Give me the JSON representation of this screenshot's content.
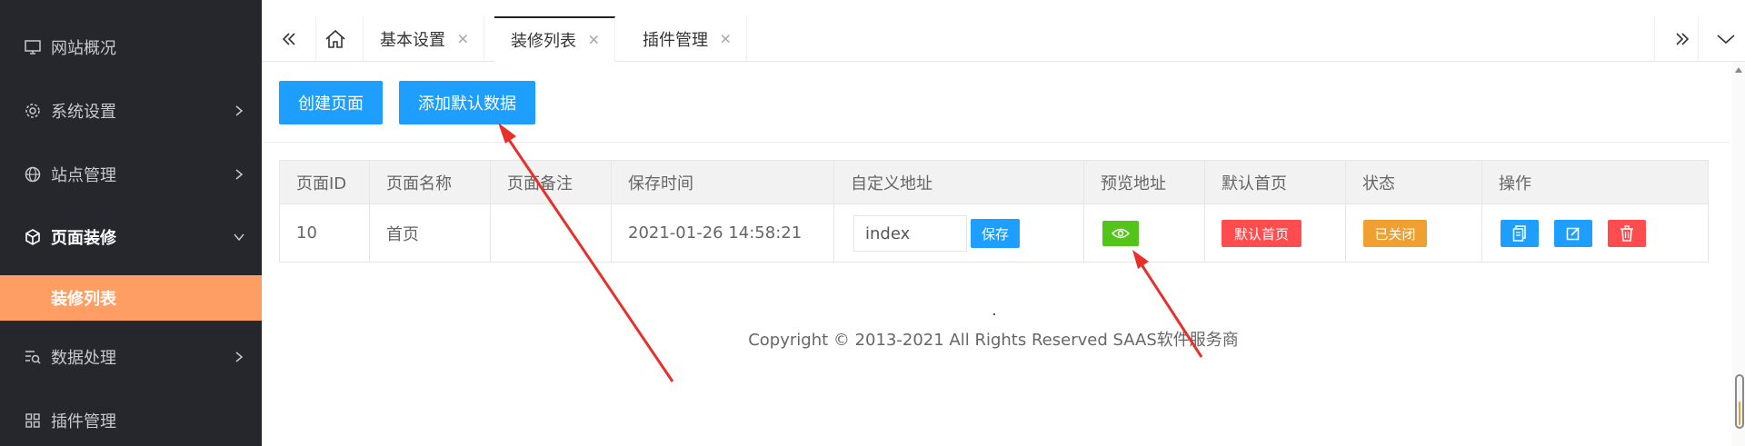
{
  "sidebar": {
    "items": [
      {
        "label": "网站概况",
        "icon": "monitor-icon"
      },
      {
        "label": "系统设置",
        "icon": "gear-icon"
      },
      {
        "label": "站点管理",
        "icon": "globe-icon"
      },
      {
        "label": "页面装修",
        "icon": "cube-icon"
      },
      {
        "label": "数据处理",
        "icon": "data-search-icon"
      },
      {
        "label": "插件管理",
        "icon": "grid-icon"
      }
    ],
    "sub_active": "装修列表"
  },
  "tabs": [
    {
      "label": "基本设置"
    },
    {
      "label": "装修列表"
    },
    {
      "label": "插件管理"
    }
  ],
  "toolbar": {
    "create_label": "创建页面",
    "add_default_label": "添加默认数据"
  },
  "table": {
    "headers": [
      "页面ID",
      "页面名称",
      "页面备注",
      "保存时间",
      "自定义地址",
      "预览地址",
      "默认首页",
      "状态",
      "操作"
    ],
    "rows": [
      {
        "id": "10",
        "name": "首页",
        "note": "",
        "saved_at": "2021-01-26 14:58:21",
        "custom_url": "index",
        "save_label": "保存",
        "default_home": "默认首页",
        "status": "已关闭"
      }
    ]
  },
  "footer": {
    "copyright": "Copyright © 2013-2021 All Rights Reserved SAAS软件服务商"
  },
  "colors": {
    "sidebar_bg": "#25272d",
    "active_orange": "#ff9e64",
    "primary_blue": "#1e9fff",
    "green": "#52c41a",
    "red": "#ff5555",
    "amber": "#f0a030",
    "annotation_red": "#e8302a"
  }
}
